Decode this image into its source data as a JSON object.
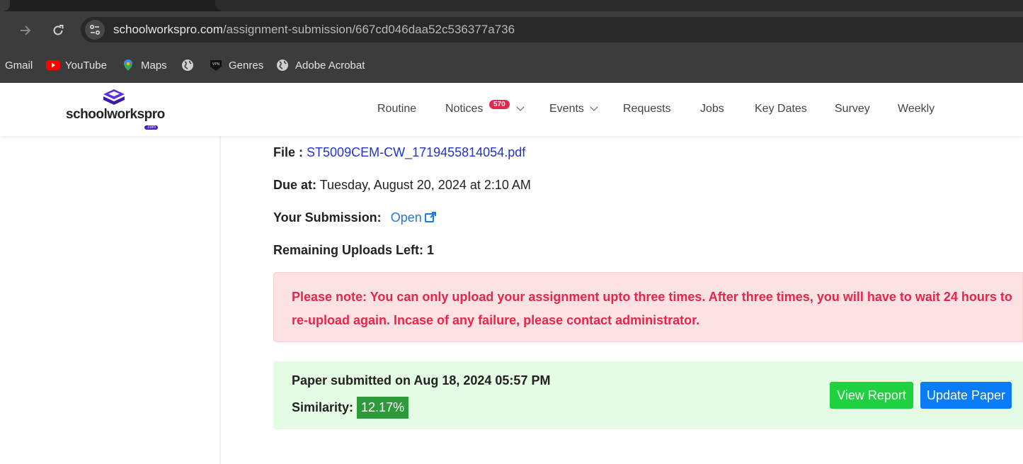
{
  "browser": {
    "url_host": "schoolworkspro.com",
    "url_path": "/assignment-submission/667cd046daa52c536377a736",
    "bookmarks": [
      {
        "label": "Gmail",
        "icon": "gmail-icon"
      },
      {
        "label": "YouTube",
        "icon": "youtube-icon"
      },
      {
        "label": "Maps",
        "icon": "maps-icon"
      },
      {
        "label": "",
        "icon": "globe-icon"
      },
      {
        "label": "Genres",
        "icon": "vpn-icon"
      },
      {
        "label": "Adobe Acrobat",
        "icon": "globe-icon"
      }
    ]
  },
  "site": {
    "logo_text": "schoolworkspro",
    "logo_suffix": ".com",
    "nav": [
      {
        "label": "Routine"
      },
      {
        "label": "Notices",
        "badge": "570",
        "dropdown": true
      },
      {
        "label": "Events",
        "dropdown": true
      },
      {
        "label": "Requests"
      },
      {
        "label": "Jobs"
      },
      {
        "label": "Key Dates"
      },
      {
        "label": "Survey"
      },
      {
        "label": "Weekly"
      }
    ]
  },
  "assignment": {
    "file_label": "File :",
    "file_name": "ST5009CEM-CW_1719455814054.pdf",
    "due_label": "Due at:",
    "due_value": "Tuesday, August 20, 2024 at 2:10 AM",
    "submission_label": "Your Submission:",
    "submission_link": "Open",
    "remaining_label": "Remaining Uploads Left: 1"
  },
  "notice": {
    "text": "Please note: You can only upload your assignment upto three times. After three times, you will have to wait 24 hours to re-upload again. Incase of any failure, please contact administrator."
  },
  "submission_status": {
    "submitted_text": "Paper submitted on Aug 18, 2024 05:57 PM",
    "similarity_label": "Similarity:",
    "similarity_value": "12.17%",
    "view_report_label": "View Report",
    "update_paper_label": "Update Paper"
  },
  "colors": {
    "danger": "#e8254b",
    "success_bg": "#e4fbe4",
    "primary": "#0a7cf7",
    "green_button": "#1fd13e"
  }
}
